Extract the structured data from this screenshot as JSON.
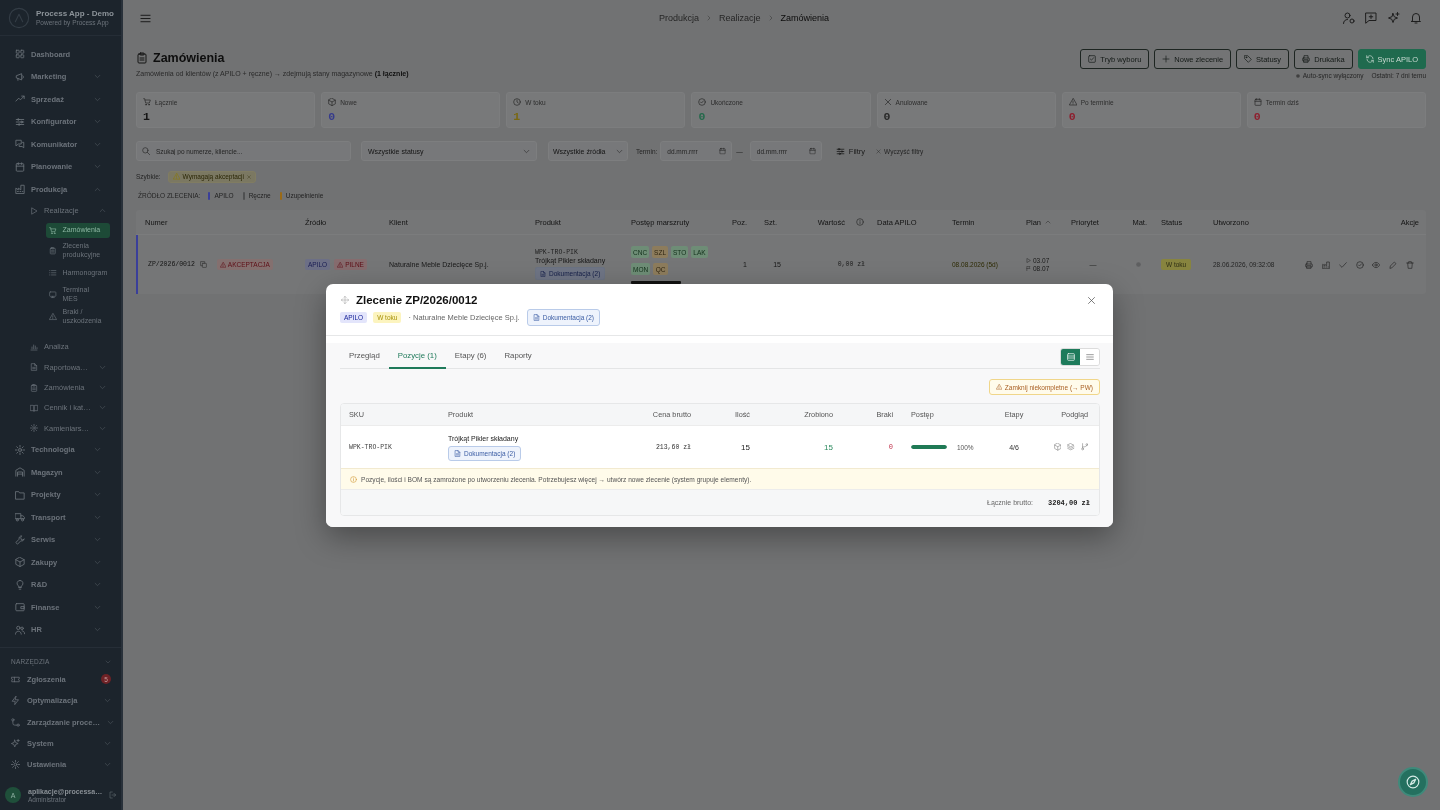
{
  "sidebar": {
    "app_name": "Process App - Demo",
    "app_subtitle": "Powered by Process App",
    "nav": [
      {
        "label": "Dashboard",
        "selected": false
      },
      {
        "label": "Marketing",
        "selected": false,
        "expanded": false
      },
      {
        "label": "Sprzedaż",
        "selected": false,
        "expanded": false
      },
      {
        "label": "Konfigurator",
        "selected": false,
        "expanded": false
      },
      {
        "label": "Komunikator",
        "selected": false,
        "expanded": false
      },
      {
        "label": "Planowanie",
        "selected": false,
        "expanded": false
      },
      {
        "label": "Produkcja",
        "selected": false,
        "expanded": true,
        "children": [
          {
            "label": "Realizacje",
            "selected": false,
            "expanded": true,
            "children": [
              {
                "label": "Zamówienia",
                "selected": true
              },
              {
                "label": "Zlecenia produkcyjne",
                "selected": false
              },
              {
                "label": "Harmonogram",
                "selected": false
              },
              {
                "label": "Terminal MES",
                "selected": false
              },
              {
                "label": "Braki / uszkodzenia",
                "selected": false
              }
            ]
          },
          {
            "label": "Analiza",
            "selected": false
          },
          {
            "label": "Raportowa…",
            "selected": false,
            "expanded": false
          },
          {
            "label": "Zamówienia",
            "selected": false,
            "expanded": false
          },
          {
            "label": "Cennik i kat…",
            "selected": false,
            "expanded": false
          },
          {
            "label": "Kamieniars…",
            "selected": false,
            "expanded": false
          }
        ]
      },
      {
        "label": "Technologia",
        "selected": false,
        "expanded": false
      },
      {
        "label": "Magazyn",
        "selected": false,
        "expanded": false
      },
      {
        "label": "Projekty",
        "selected": false,
        "expanded": false
      },
      {
        "label": "Transport",
        "selected": false,
        "expanded": false
      },
      {
        "label": "Serwis",
        "selected": false,
        "expanded": false
      },
      {
        "label": "Zakupy",
        "selected": false,
        "expanded": false
      },
      {
        "label": "R&D",
        "selected": false,
        "expanded": false
      },
      {
        "label": "Finanse",
        "selected": false,
        "expanded": false
      },
      {
        "label": "HR",
        "selected": false,
        "expanded": false
      }
    ],
    "tools": {
      "title": "NARZĘDZIA",
      "expanded": true,
      "items": [
        {
          "label": "Zgłoszenia",
          "selected": false,
          "badge": "5"
        },
        {
          "label": "Optymalizacja",
          "selected": false,
          "expanded": false
        },
        {
          "label": "Zarządzanie proce…",
          "selected": false,
          "expanded": false
        },
        {
          "label": "System",
          "selected": false,
          "expanded": false
        },
        {
          "label": "Ustawienia",
          "selected": false,
          "expanded": false
        }
      ]
    },
    "user": {
      "initial": "A",
      "name": "aplikacje@processa…",
      "role": "Administrator"
    }
  },
  "topbar": {
    "breadcrumbs": [
      "Produkcja",
      "Realizacje",
      "Zamówienia"
    ]
  },
  "page_header": {
    "title": "Zamówienia",
    "subtitle": "Zamówienia od klientów (z APILO + ręczne) → zdejmują stany magazynowe **(1 łącznie)**",
    "buttons": [
      {
        "label": "Tryb wyboru",
        "kind": "outline"
      },
      {
        "label": "Nowe zlecenie",
        "kind": "outline"
      },
      {
        "label": "Statusy",
        "kind": "outline"
      },
      {
        "label": "Drukarka",
        "kind": "outline"
      },
      {
        "label": "Sync APILO",
        "kind": "primary"
      }
    ],
    "auto_sync": "Auto-sync wyłączony",
    "last_sync": "Ostatni: 7 dni temu"
  },
  "stats": [
    {
      "label": "Łącznie",
      "value": "1",
      "color": "#161616"
    },
    {
      "label": "Nowe",
      "value": "0",
      "color": "#363b8c"
    },
    {
      "label": "W toku",
      "value": "1",
      "color": "#7a6812"
    },
    {
      "label": "Ukończone",
      "value": "0",
      "color": "#24694b"
    },
    {
      "label": "Anulowane",
      "value": "0",
      "color": "#282828"
    },
    {
      "label": "Po terminie",
      "value": "0",
      "color": "#8e1f2e"
    },
    {
      "label": "Termin dziś",
      "value": "0",
      "color": "#8e1f2e"
    }
  ],
  "filters": {
    "search": {
      "placeholder": "Szukaj po numerze, kliencie..."
    },
    "status": {
      "value": "Wszystkie statusy"
    },
    "source": {
      "value": "Wszystkie źródła"
    },
    "due_label": "Termin:",
    "due_from": {
      "placeholder": "dd.mm.rrrr"
    },
    "range_separator": "—",
    "due_to": {
      "placeholder": "dd.mm.rrrr"
    },
    "filters_button": "Filtry",
    "clear_button": "Wyczyść filtry"
  },
  "quick_filters": {
    "label": "Szybkie:",
    "chips": [
      {
        "label": "Wymagają akceptacji",
        "selected": true
      }
    ]
  },
  "legend": {
    "title": "ŹRÓDŁO ZLECENIA:",
    "items": [
      {
        "label": "APILO",
        "color": "#3a3f9a"
      },
      {
        "label": "Ręczne",
        "color": "#4f5051"
      },
      {
        "label": "Uzupełnienie",
        "color": "#9a6a16"
      }
    ]
  },
  "orders_table": {
    "columns": [
      {
        "label": "Numer"
      },
      {
        "label": "Źródło"
      },
      {
        "label": "Klient"
      },
      {
        "label": "Produkt"
      },
      {
        "label": "Postęp marszruty"
      },
      {
        "label": "Poz."
      },
      {
        "label": "Szt."
      },
      {
        "label": "Wartość",
        "info": true
      },
      {
        "label": "Data APILO"
      },
      {
        "label": "Termin"
      },
      {
        "label": "Plan",
        "sorted": true
      },
      {
        "label": "Priorytet"
      },
      {
        "label": "Mat."
      },
      {
        "label": "Status"
      },
      {
        "label": "Utworzono"
      },
      {
        "label": "Akcje"
      }
    ],
    "rows": [
      {
        "color": "#3a3f9a",
        "number": "ZP/2026/0012",
        "flags": [
          "AKCEPTACJA"
        ],
        "sources": [
          {
            "label": "APILO",
            "kind": "source"
          },
          {
            "label": "PILNE",
            "kind": "urgent"
          }
        ],
        "client": "Naturalne Meble Dziecięce Sp.j.",
        "sku": "WPK-TRO-PIK",
        "product": "Trójkąt Pikler składany",
        "docs": "Dokumentacja (2)",
        "route": [
          {
            "label": "CNC",
            "color": "#6e8d76"
          },
          {
            "label": "SZL",
            "color": "#8d7c5c"
          },
          {
            "label": "STO",
            "color": "#6e8d76"
          },
          {
            "label": "LAK",
            "color": "#6e8d76"
          },
          {
            "label": "MON",
            "color": "#6e8d76"
          },
          {
            "label": "QC",
            "color": "#8d7c5c"
          }
        ],
        "positions": "1",
        "pieces": "15",
        "value": "0,00 zł",
        "due": "08.08.2026 (5d)",
        "plan_start": "03.07",
        "plan_end": "08.07",
        "priority": "—",
        "material": {
          "color": "#5e5f60"
        },
        "status": {
          "label": "W toku",
          "color": "#87843f"
        },
        "created": "28.06.2026, 09:32:08"
      }
    ]
  },
  "modal": {
    "title": "Zlecenie ZP/2026/0012",
    "badges": [
      {
        "label": "APILO",
        "color": "#e3e5fb"
      },
      {
        "label": "W toku",
        "color": "#fcf4bf"
      }
    ],
    "client": "· Naturalne Meble Dziecięce Sp.j.",
    "docs": "Dokumentacja (2)",
    "tabs": [
      {
        "label": "Przegląd",
        "selected": false
      },
      {
        "label": "Pozycje (1)",
        "selected": true
      },
      {
        "label": "Etapy (6)",
        "selected": false
      },
      {
        "label": "Raporty",
        "selected": false
      }
    ],
    "views": [
      {
        "kind": "cards",
        "selected": true
      },
      {
        "kind": "list",
        "selected": false
      }
    ],
    "close_incomplete": "Zamknij niekompletne (→ PW)",
    "table": {
      "columns": [
        "SKU",
        "Produkt",
        "Cena brutto",
        "Ilość",
        "Zrobiono",
        "Braki",
        "Postęp",
        "Etapy",
        "Podgląd"
      ],
      "rows": [
        {
          "sku": "WPK-TRO-PIK",
          "product": "Trójkąt Pikler składany",
          "docs": "Dokumentacja (2)",
          "price": "213,60 zł",
          "quantity": "15",
          "done": "15",
          "defects": "0",
          "level": 1,
          "percent": "100%",
          "stages": "4/6"
        }
      ],
      "notice": "Pozycje, ilości i BOM są zamrożone po utworzeniu zlecenia. Potrzebujesz więcej → utwórz nowe zlecenie (system grupuje elementy).",
      "total_label": "Łącznie brutto:",
      "total": "3204,00 zł"
    }
  }
}
